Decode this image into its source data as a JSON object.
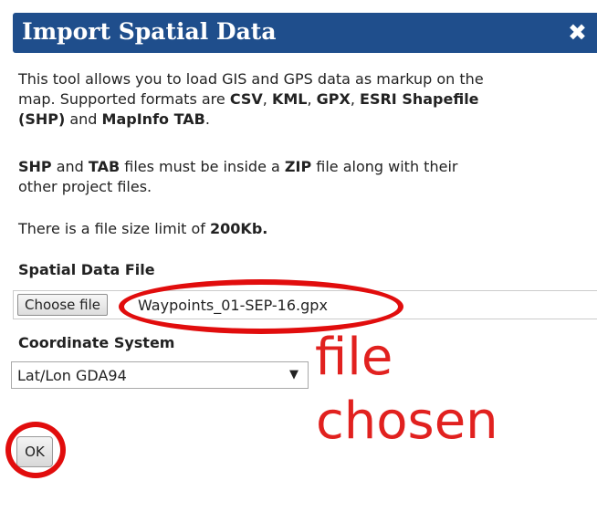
{
  "dialog": {
    "title": "Import Spatial Data",
    "close_glyph": "✖",
    "intro": {
      "line1": "This tool allows you to load GIS and GPS data as markup on the",
      "line2_a": "map. Supported formats are ",
      "fmt_csv": "CSV",
      "sep1": ", ",
      "fmt_kml": "KML",
      "sep2": ", ",
      "fmt_gpx": "GPX",
      "sep3": ", ",
      "fmt_shapefile": "ESRI Shapefile",
      "line3_shp": "(SHP)",
      "and": " and ",
      "fmt_tab": "MapInfo TAB",
      "end": "."
    },
    "zip_note": {
      "shp": "SHP",
      "and": " and ",
      "tab": "TAB",
      "mid": " files must be inside a ",
      "zip": "ZIP",
      "end": " file along with their",
      "line2": "other project files."
    },
    "size_note": {
      "prefix": "There is a file size limit of ",
      "limit": "200Kb."
    },
    "file_label": "Spatial Data File",
    "choose_button": "Choose file",
    "file_name": "Waypoints_01-SEP-16.gpx",
    "coord_label": "Coordinate System",
    "coord_value": "Lat/Lon GDA94",
    "select_arrow": "▼",
    "ok_button": "OK"
  },
  "annotation": {
    "word1": "file",
    "word2": "chosen",
    "color": "#e1211f"
  },
  "colors": {
    "title_bar": "#1f4e8c",
    "annotation_red": "#e10d0d"
  }
}
